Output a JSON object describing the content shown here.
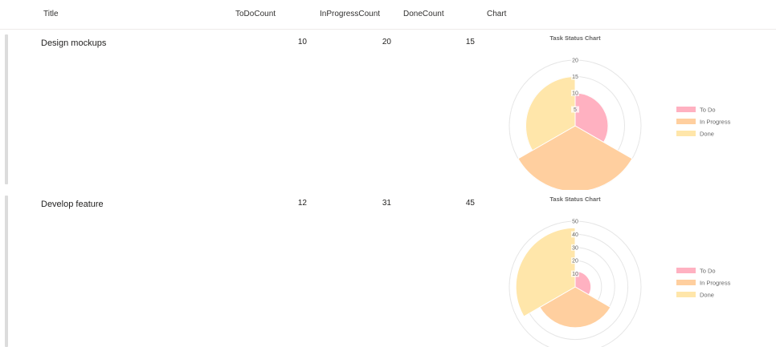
{
  "columns": {
    "title": "Title",
    "todo": "ToDoCount",
    "inprogress": "InProgressCount",
    "done": "DoneCount",
    "chart": "Chart"
  },
  "rows": [
    {
      "title": "Design mockups",
      "todo": "10",
      "inprogress": "20",
      "done": "15"
    },
    {
      "title": "Develop feature",
      "todo": "12",
      "inprogress": "31",
      "done": "45"
    }
  ],
  "chart_data": [
    {
      "type": "polarArea",
      "title": "Task Status Chart",
      "categories": [
        "To Do",
        "In Progress",
        "Done"
      ],
      "values": [
        10,
        20,
        15
      ],
      "r_range": [
        0,
        20
      ],
      "r_ticks": [
        "5",
        "10",
        "15",
        "20"
      ],
      "legend_position": "right",
      "colors": [
        "#ffb1c1",
        "#ffcf9f",
        "#ffe6aa"
      ]
    },
    {
      "type": "polarArea",
      "title": "Task Status Chart",
      "categories": [
        "To Do",
        "In Progress",
        "Done"
      ],
      "values": [
        12,
        31,
        45
      ],
      "r_range": [
        0,
        50
      ],
      "r_ticks": [
        "10",
        "20",
        "30",
        "40",
        "50"
      ],
      "legend_position": "right",
      "colors": [
        "#ffb1c1",
        "#ffcf9f",
        "#ffe6aa"
      ]
    }
  ]
}
